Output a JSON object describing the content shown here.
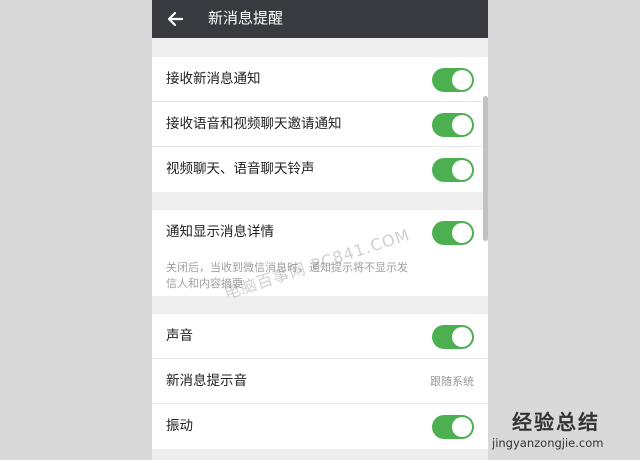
{
  "header": {
    "back_icon": "arrow-left-icon",
    "title": "新消息提醒"
  },
  "section1": {
    "rows": [
      {
        "label": "接收新消息通知",
        "toggle": true
      },
      {
        "label": "接收语音和视频聊天邀请通知",
        "toggle": true
      },
      {
        "label": "视频聊天、语音聊天铃声",
        "toggle": true
      }
    ]
  },
  "section2": {
    "label": "通知显示消息详情",
    "toggle": true,
    "description": "关闭后，当收到微信消息时，通知提示将不显示发信人和内容摘要"
  },
  "section3": {
    "rows": [
      {
        "label": "声音",
        "toggle": true
      },
      {
        "label": "新消息提示音",
        "value": "跟随系统"
      },
      {
        "label": "振动",
        "toggle": true
      }
    ]
  },
  "watermark": "电脑百事网 PC841.COM",
  "site_logo": {
    "main": "经验总结",
    "url": "jingyanzongjie.com"
  },
  "colors": {
    "titlebar": "#393a3f",
    "toggle_on": "#4caf50",
    "page_bg": "#eeeeee"
  }
}
